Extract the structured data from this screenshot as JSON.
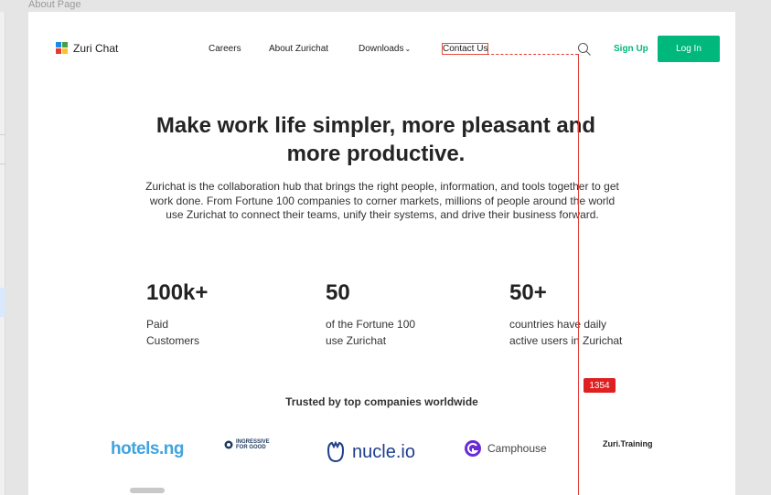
{
  "canvas": {
    "frame_label": "About Page"
  },
  "nav": {
    "logo_text": "Zuri Chat",
    "links": [
      "Careers",
      "About Zurichat",
      "Downloads",
      "Contact Us"
    ],
    "downloads_chevron": "⌄",
    "signup": "Sign Up",
    "login": "Log In",
    "colors": {
      "accent": "#00b87c",
      "logo_squares": [
        "#1e88e5",
        "#e53935",
        "#fbc02d",
        "#43a047"
      ]
    }
  },
  "hero": {
    "title_line1": "Make work life simpler, more pleasant and",
    "title_line2": "more productive.",
    "description": "Zurichat is the collaboration hub that brings the right people, information, and tools together to get work done. From Fortune 100 companies to corner markets, millions of people around the world use Zurichat to connect their teams, unify their systems, and drive their business forward."
  },
  "stats": [
    {
      "value": "100k+",
      "label_line1": "Paid",
      "label_line2": "Customers"
    },
    {
      "value": "50",
      "label_line1": "of the Fortune 100",
      "label_line2": "use Zurichat"
    },
    {
      "value": "50+",
      "label_line1": "countries have daily",
      "label_line2": "active users in Zurichat"
    }
  ],
  "trusted": {
    "heading": "Trusted by top companies worldwide",
    "brands": {
      "hotels": "hotels.ng",
      "ingressive_line1": "INGRESSIVE",
      "ingressive_line2": "FOR GOOD",
      "nucleio": "nucle.io",
      "camphouse": "Camphouse",
      "zuritraining": "Zuri.Training"
    }
  },
  "overlay": {
    "measurement_badge": "1354",
    "color": "#e53935"
  },
  "icons": [
    "logo-mark-icon",
    "search-icon",
    "chevron-down-icon",
    "nucleio-logo-icon",
    "camphouse-logo-icon",
    "ingressive-logo-icon"
  ]
}
